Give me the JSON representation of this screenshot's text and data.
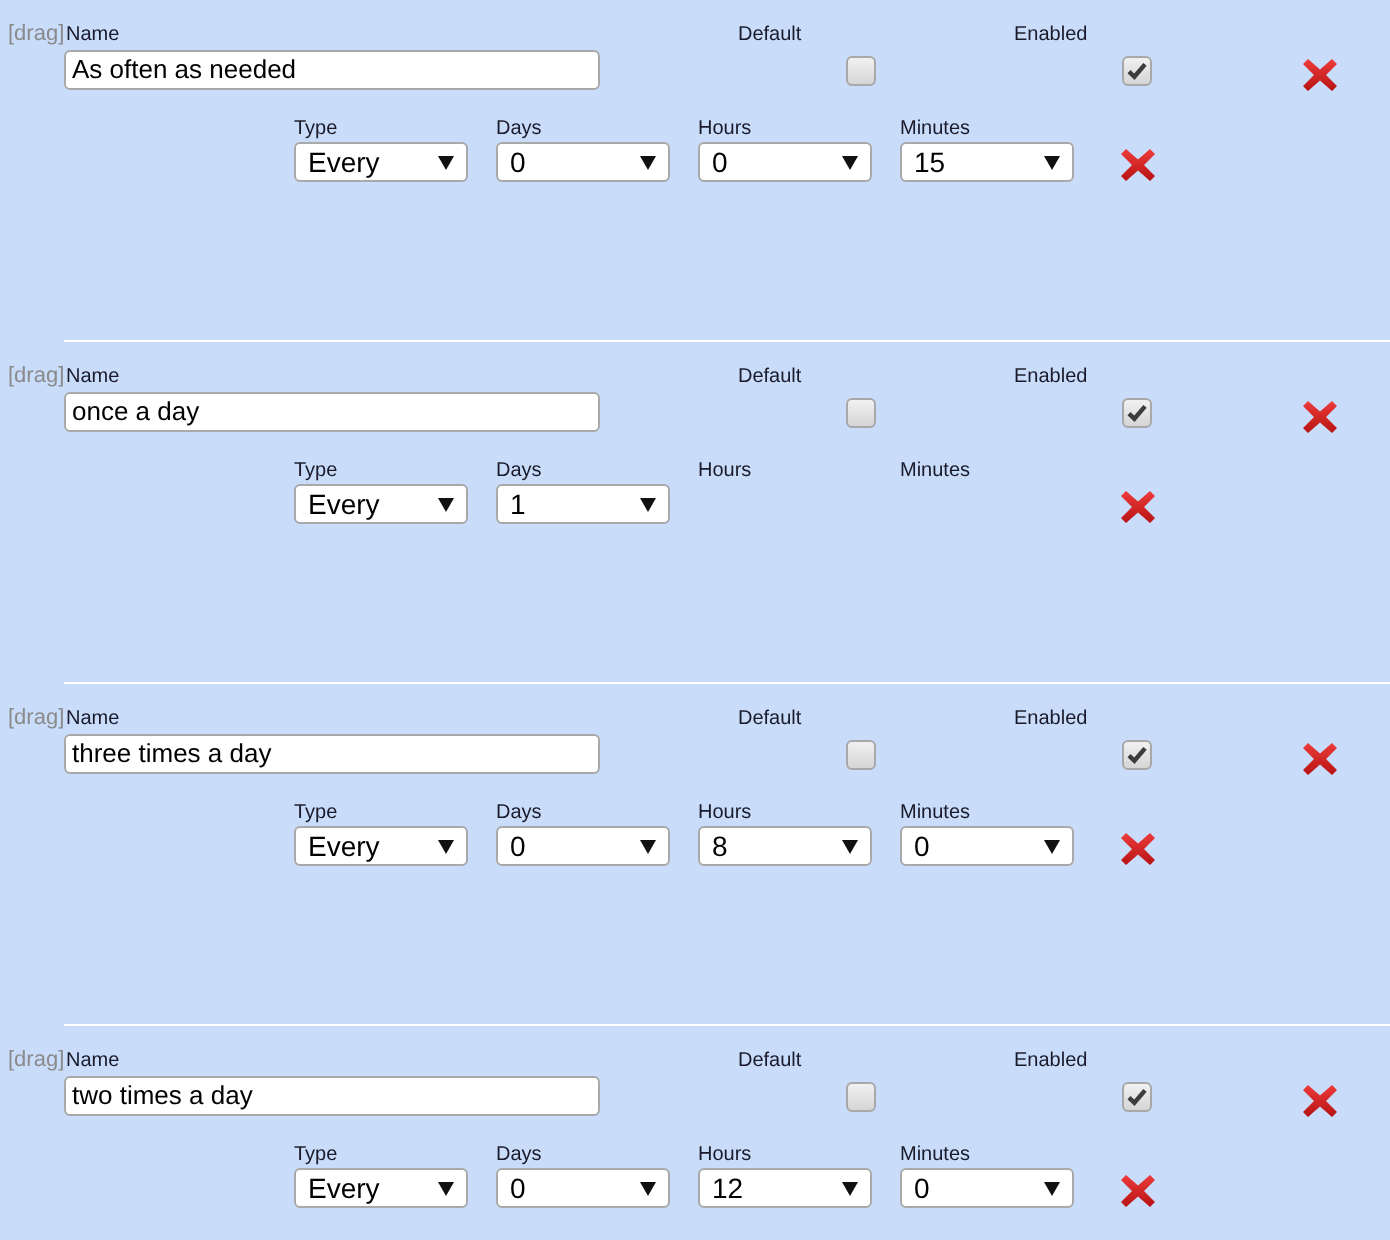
{
  "schedules": [
    {
      "drag": "[drag]",
      "name_label": "Name",
      "name": "As often as needed",
      "default_label": "Default",
      "default": false,
      "enabled_label": "Enabled",
      "enabled": true,
      "fields": [
        {
          "label": "Type",
          "value": "Every"
        },
        {
          "label": "Days",
          "value": "0"
        },
        {
          "label": "Hours",
          "value": "0"
        },
        {
          "label": "Minutes",
          "value": "15"
        }
      ]
    },
    {
      "drag": "[drag]",
      "name_label": "Name",
      "name": "once a day",
      "default_label": "Default",
      "default": false,
      "enabled_label": "Enabled",
      "enabled": true,
      "fields": [
        {
          "label": "Type",
          "value": "Every"
        },
        {
          "label": "Days",
          "value": "1"
        },
        {
          "label": "Hours"
        },
        {
          "label": "Minutes"
        }
      ]
    },
    {
      "drag": "[drag]",
      "name_label": "Name",
      "name": "three times a day",
      "default_label": "Default",
      "default": false,
      "enabled_label": "Enabled",
      "enabled": true,
      "fields": [
        {
          "label": "Type",
          "value": "Every"
        },
        {
          "label": "Days",
          "value": "0"
        },
        {
          "label": "Hours",
          "value": "8"
        },
        {
          "label": "Minutes",
          "value": "0"
        }
      ]
    },
    {
      "drag": "[drag]",
      "name_label": "Name",
      "name": "two times a day",
      "default_label": "Default",
      "default": false,
      "enabled_label": "Enabled",
      "enabled": true,
      "fields": [
        {
          "label": "Type",
          "value": "Every"
        },
        {
          "label": "Days",
          "value": "0"
        },
        {
          "label": "Hours",
          "value": "12"
        },
        {
          "label": "Minutes",
          "value": "0"
        }
      ]
    }
  ]
}
